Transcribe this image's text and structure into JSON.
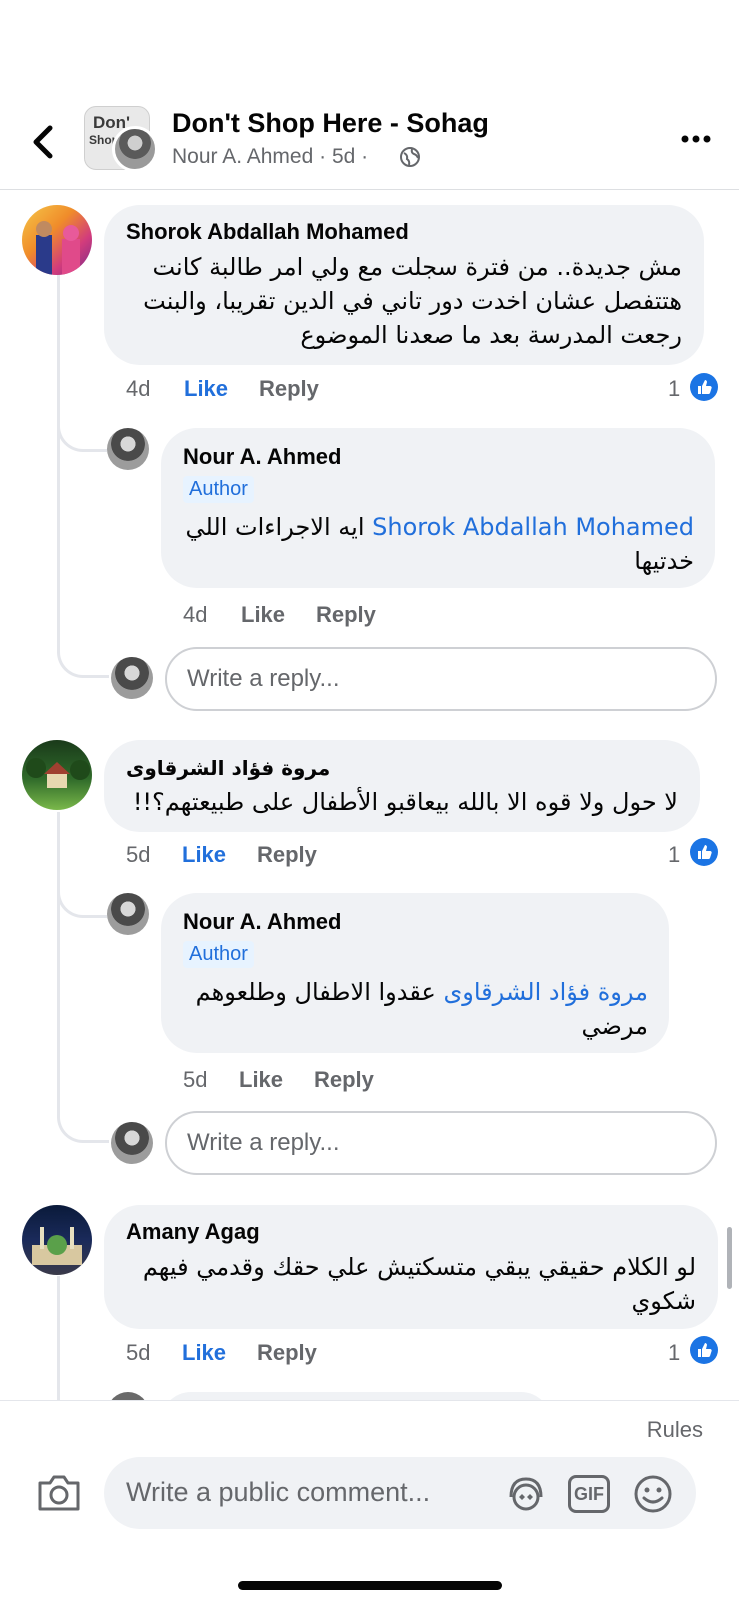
{
  "header": {
    "group_name": "Don't Shop Here - Sohag",
    "group_thumb_line1": "Don'",
    "group_thumb_line2": "Shop",
    "poster": "Nour A. Ahmed",
    "time": "5d",
    "separator": "·",
    "icons": {
      "back": "chevron-left-icon",
      "privacy": "globe-icon",
      "more": "more-icon"
    }
  },
  "comments": [
    {
      "author": "Shorok Abdallah Mohamed",
      "text": "مش جديدة.. من فترة سجلت مع ولي امر طالبة كانت هتتفصل عشان اخدت دور تاني في الدين تقريبا، والبنت رجعت المدرسة بعد ما صعدنا الموضوع",
      "time": "4d",
      "like": "Like",
      "reply": "Reply",
      "reactions": "1",
      "replies": [
        {
          "author": "Nour A. Ahmed",
          "badge": "Author",
          "mention": "Shorok Abdallah Mohamed",
          "text": "ايه الاجراءات اللي خدتيها",
          "time": "4d",
          "like": "Like",
          "reply": "Reply"
        }
      ],
      "reply_placeholder": "Write a reply..."
    },
    {
      "author": "مروة فؤاد الشرقاوى",
      "text": "لا حول ولا قوه الا بالله بيعاقبو الأطفال على طبيعتهم؟!!",
      "time": "5d",
      "like": "Like",
      "reply": "Reply",
      "reactions": "1",
      "replies": [
        {
          "author": "Nour A. Ahmed",
          "badge": "Author",
          "mention": "مروة فؤاد الشرقاوى",
          "text": "عقدوا الاطفال وطلعوهم مرضي",
          "time": "5d",
          "like": "Like",
          "reply": "Reply"
        }
      ],
      "reply_placeholder": "Write a reply..."
    },
    {
      "author": "Amany Agag",
      "text": "لو الكلام حقيقي يبقي متسكتيش علي حقك وقدمي فيهم شكوي",
      "time": "5d",
      "like": "Like",
      "reply": "Reply",
      "reactions": "1"
    }
  ],
  "footer": {
    "rules": "Rules",
    "composer_placeholder": "Write a public comment...",
    "icons": {
      "camera": "camera-icon",
      "avatar_sticker": "avatar-sticker-icon",
      "gif": "gif-icon",
      "emoji": "emoji-icon"
    },
    "gif_label": "GIF"
  },
  "colors": {
    "link": "#216fdb",
    "bubble": "#f0f2f5",
    "like_badge": "#1b74e4",
    "muted": "#65676b"
  }
}
